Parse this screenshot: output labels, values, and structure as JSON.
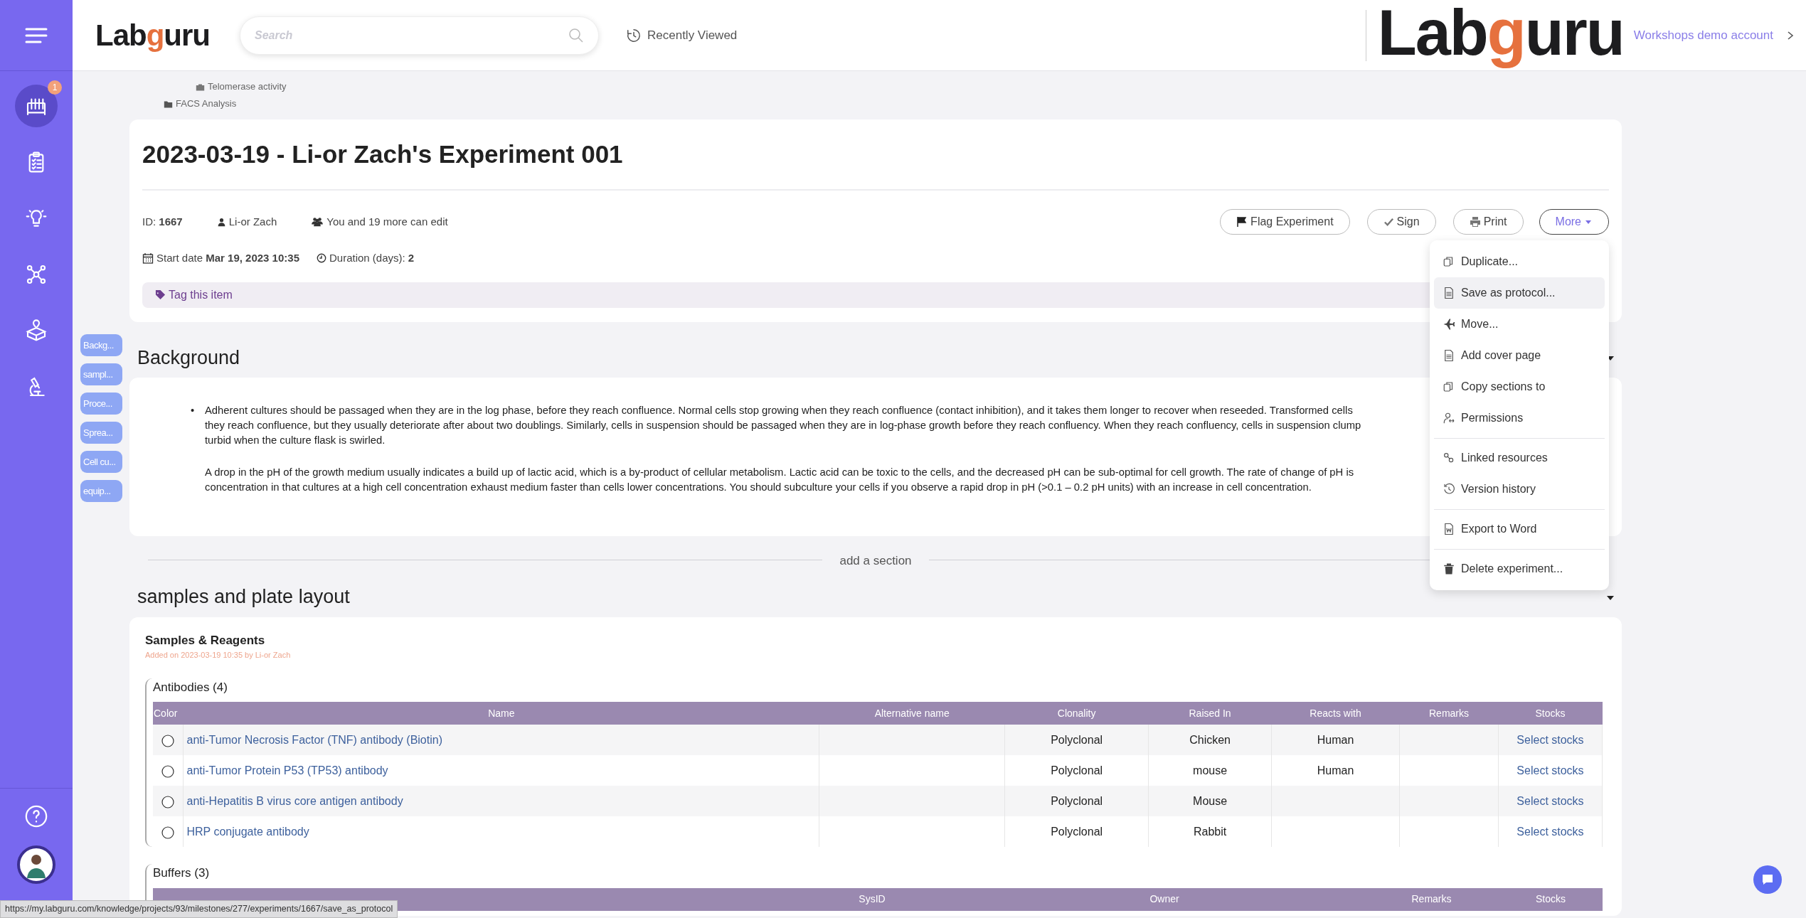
{
  "sidebar": {
    "items": [
      {
        "kind": "racks",
        "selected": true,
        "badge": "1"
      },
      {
        "kind": "clipboard",
        "selected": false
      },
      {
        "kind": "bulb",
        "selected": false
      },
      {
        "kind": "network",
        "selected": false
      },
      {
        "kind": "box",
        "selected": false
      },
      {
        "kind": "microscope",
        "selected": false
      }
    ],
    "footer": [
      {
        "kind": "help"
      },
      {
        "kind": "avatar"
      }
    ]
  },
  "header": {
    "logo": "Labguru",
    "search": {
      "placeholder": "Search"
    },
    "recently_viewed": "Recently Viewed",
    "brand_logo": "Labguru",
    "account": "Workshops demo account"
  },
  "breadcrumbs": [
    {
      "kind": "project",
      "label": "Telomerase activity"
    },
    {
      "kind": "folder",
      "label": "FACS Analysis"
    }
  ],
  "section_nav": [
    "Backg...",
    "sampl...",
    "Proce...",
    "Sprea...",
    "Cell cu...",
    "equip..."
  ],
  "experiment": {
    "title": "2023-03-19 - Li-or Zach's Experiment 001",
    "id_label": "ID:",
    "id": "1667",
    "owner": "Li-or Zach",
    "editors": "You and 19 more can edit",
    "start_label": "Start date",
    "start_date": "Mar 19, 2023 10:35",
    "duration_label": "Duration (days):",
    "duration": "2",
    "tag_prompt": "Tag this item"
  },
  "actions": [
    {
      "kind": "flag",
      "label": "Flag Experiment"
    },
    {
      "kind": "sign",
      "label": "Sign"
    },
    {
      "kind": "print",
      "label": "Print"
    },
    {
      "kind": "more",
      "label": "More",
      "expanded": true
    }
  ],
  "more_menu": [
    {
      "label": "Duplicate...",
      "hovered": false,
      "divider_before": false
    },
    {
      "label": "Save as protocol...",
      "hovered": true,
      "divider_before": false
    },
    {
      "label": "Move...",
      "hovered": false,
      "divider_before": false
    },
    {
      "label": "Add cover page",
      "hovered": false,
      "divider_before": false
    },
    {
      "label": "Copy sections to",
      "hovered": false,
      "divider_before": false
    },
    {
      "label": "Permissions",
      "hovered": false,
      "divider_before": false
    },
    {
      "label": "Linked resources",
      "hovered": false,
      "divider_before": true
    },
    {
      "label": "Version history",
      "hovered": false,
      "divider_before": false
    },
    {
      "label": "Export to Word",
      "hovered": false,
      "divider_before": true
    },
    {
      "label": "Delete experiment...",
      "hovered": false,
      "divider_before": true
    }
  ],
  "background": {
    "title": "Background",
    "paragraphs": [
      {
        "bullet": "•",
        "lines": [
          "Adherent cultures should be passaged when they are in the log phase, before they reach confluence.  Normal cells stop growing when they reach confluence (contact inhibition), and it takes them longer to recover when reseeded.  Transformed cells",
          "they reach confluence, but they usually deteriorate after about two doublings. Similarly, cells in suspension should be passaged when they are in log-phase growth before they reach confluency.  When they reach confluency, cells in suspension clump",
          "turbid when the culture flask is swirled."
        ]
      },
      {
        "lines": [
          "A drop in the pH of the growth medium usually indicates a build up of lactic acid, which is a by-product of cellular metabolism.  Lactic acid can be toxic to the cells, and the decreased pH can be sub-optimal for cell growth.  The rate of change of pH is",
          "concentration in that cultures at a high cell concentration exhaust medium faster than cells lower concentrations.  You should subculture your cells if you observe a rapid drop in pH (>0.1 – 0.2 pH units) with an increase in cell concentration."
        ]
      }
    ]
  },
  "add_section": "add a section",
  "samples_section": {
    "title": "samples and plate layout",
    "card_title": "Samples & Reagents",
    "added": "Added on 2023-03-19 10:35 by Li-or Zach",
    "antibodies": {
      "title": "Antibodies (4)",
      "columns": [
        "Color",
        "Name",
        "Alternative name",
        "Clonality",
        "Raised In",
        "Reacts with",
        "Remarks",
        "Stocks"
      ],
      "rows": [
        {
          "name": "anti-Tumor Necrosis Factor (TNF) antibody (Biotin)",
          "clonality": "Polyclonal",
          "raised_in": "Chicken",
          "reacts_with": "Human",
          "stocks": "Select stocks"
        },
        {
          "name": "anti-Tumor Protein P53 (TP53) antibody",
          "clonality": "Polyclonal",
          "raised_in": "mouse",
          "reacts_with": "Human",
          "stocks": "Select stocks"
        },
        {
          "name": "anti-Hepatitis B virus core antigen antibody",
          "clonality": "Polyclonal",
          "raised_in": "Mouse",
          "stocks": "Select stocks"
        },
        {
          "name": "HRP conjugate antibody",
          "clonality": "Polyclonal",
          "raised_in": "Rabbit",
          "stocks": "Select stocks"
        }
      ]
    },
    "buffers": {
      "title": "Buffers (3)",
      "columns": [
        "SysID",
        "Owner",
        "Remarks",
        "Stocks"
      ]
    }
  },
  "status_bar": "https://my.labguru.com/knowledge/projects/93/milestones/277/experiments/1667/save_as_protocol"
}
